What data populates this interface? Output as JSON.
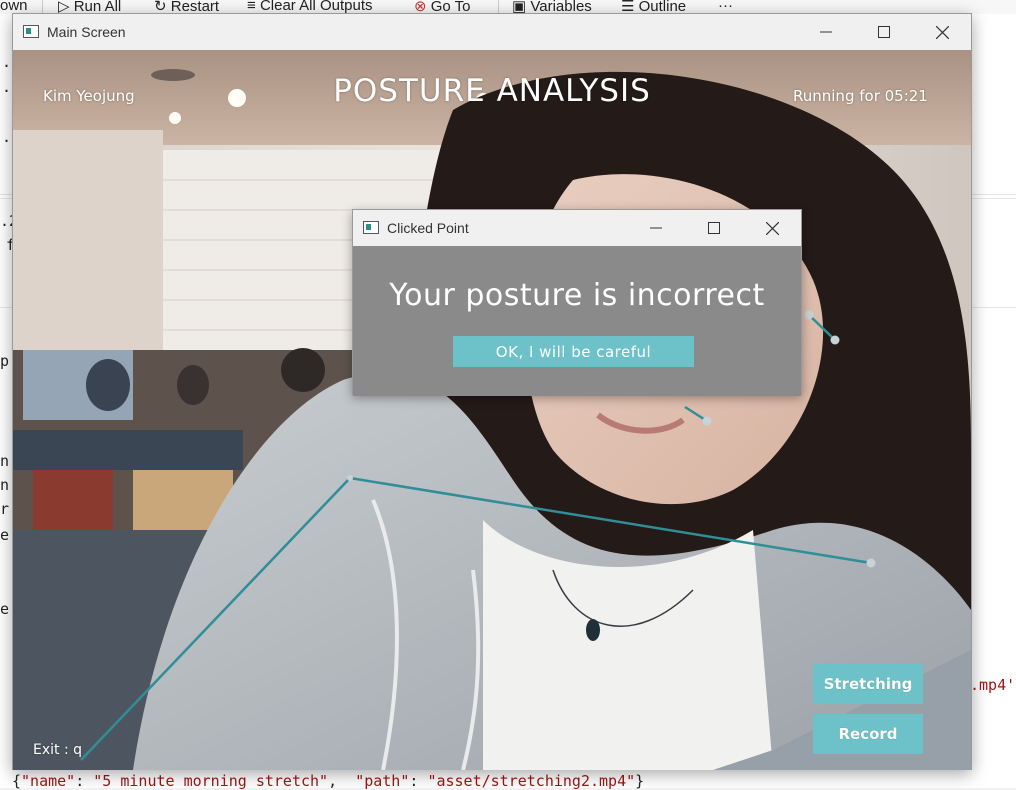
{
  "toolbar": {
    "items": [
      "own",
      "Run All",
      "Restart",
      "Clear All Outputs",
      "Go To",
      "Variables",
      "Outline",
      "···"
    ]
  },
  "editor": {
    "left_fragments": [
      ".",
      ".",
      ".",
      ".2",
      "f",
      "p",
      "n",
      "n",
      "r",
      "e",
      "e"
    ],
    "right_fragment": ".mp4'",
    "bottom_line_parts": [
      "{",
      "\"name\"",
      ": ",
      "\"5 minute morning stretch\"",
      ",  ",
      "\"path\"",
      ": ",
      "\"asset/stretching2.mp4\"",
      "}"
    ]
  },
  "main_window": {
    "title": "Main Screen",
    "user_name": "Kim Yeojung",
    "header": "POSTURE ANALYSIS",
    "running_label": "Running for  05:21",
    "exit_hint": "Exit : q",
    "stretching_button": "Stretching",
    "record_button": "Record"
  },
  "dialog": {
    "title": "Clicked Point",
    "message": "Your posture is incorrect",
    "confirm_button": "OK, I will be careful"
  },
  "colors": {
    "accent": "#6cc2c8",
    "skeleton": "#2f8e98",
    "dialog_bg": "#8a8a8a"
  },
  "icons": {
    "minimize": "minimize-icon",
    "maximize": "maximize-icon",
    "close": "close-icon",
    "app": "app-window-icon"
  }
}
